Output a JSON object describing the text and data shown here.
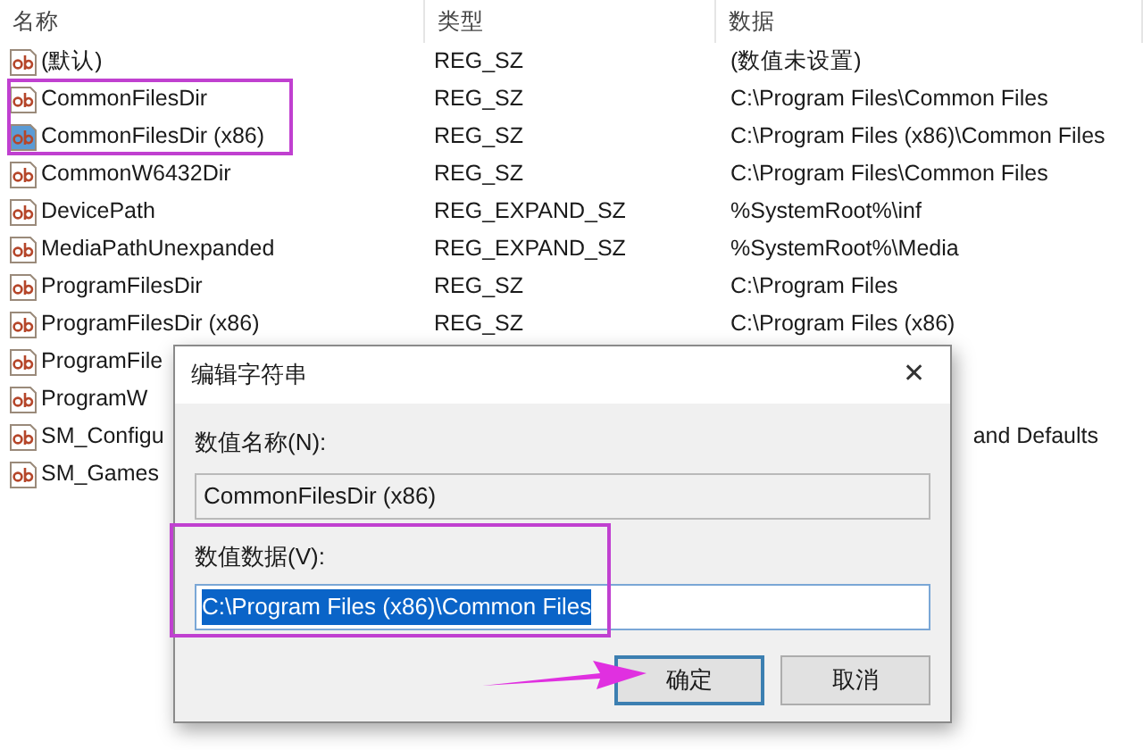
{
  "table": {
    "columns": [
      "名称",
      "类型",
      "数据"
    ],
    "rows": [
      {
        "name": "(默认)",
        "type": "REG_SZ",
        "data": "(数值未设置)",
        "selected": false
      },
      {
        "name": "CommonFilesDir",
        "type": "REG_SZ",
        "data": "C:\\Program Files\\Common Files",
        "selected": false
      },
      {
        "name": "CommonFilesDir (x86)",
        "type": "REG_SZ",
        "data": "C:\\Program Files (x86)\\Common Files",
        "selected": true
      },
      {
        "name": "CommonW6432Dir",
        "type": "REG_SZ",
        "data": "C:\\Program Files\\Common Files",
        "selected": false
      },
      {
        "name": "DevicePath",
        "type": "REG_EXPAND_SZ",
        "data": "%SystemRoot%\\inf",
        "selected": false
      },
      {
        "name": "MediaPathUnexpanded",
        "type": "REG_EXPAND_SZ",
        "data": "%SystemRoot%\\Media",
        "selected": false
      },
      {
        "name": "ProgramFilesDir",
        "type": "REG_SZ",
        "data": "C:\\Program Files",
        "selected": false
      },
      {
        "name": "ProgramFilesDir (x86)",
        "type": "REG_SZ",
        "data": "C:\\Program Files (x86)",
        "selected": false
      },
      {
        "name": "ProgramFile",
        "selected": false
      },
      {
        "name": "ProgramW",
        "selected": false
      },
      {
        "name": "SM_Configu",
        "data": "and Defaults",
        "selected": false
      },
      {
        "name": "SM_Games",
        "selected": false
      }
    ]
  },
  "dialog": {
    "title": "编辑字符串",
    "close": "✕",
    "name_label": "数值名称(N):",
    "name_value": "CommonFilesDir (x86)",
    "data_label": "数值数据(V):",
    "data_value": "C:\\Program Files (x86)\\Common Files",
    "buttons": [
      {
        "label": "确定",
        "default": true
      },
      {
        "label": "取消",
        "default": false
      }
    ]
  }
}
